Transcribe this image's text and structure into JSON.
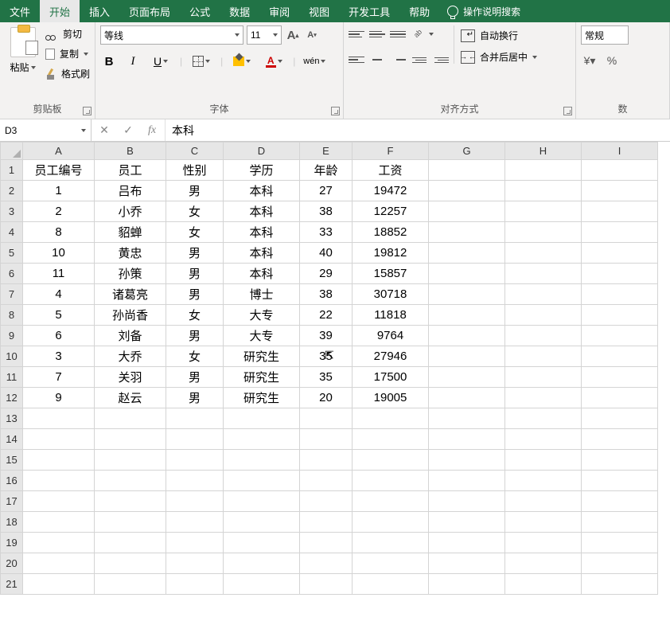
{
  "menu": {
    "tabs": [
      "文件",
      "开始",
      "插入",
      "页面布局",
      "公式",
      "数据",
      "审阅",
      "视图",
      "开发工具",
      "帮助"
    ],
    "active_index": 1,
    "search_placeholder": "操作说明搜索"
  },
  "ribbon": {
    "clipboard": {
      "paste": "粘贴",
      "cut": "剪切",
      "copy": "复制",
      "format_painter": "格式刷",
      "group_label": "剪贴板"
    },
    "font": {
      "name": "等线",
      "size": "11",
      "bold": "B",
      "italic": "I",
      "underline": "U",
      "inc_label": "A",
      "dec_label": "A",
      "color_label": "A",
      "phonetic": "wén",
      "group_label": "字体"
    },
    "alignment": {
      "wrap": "自动换行",
      "merge": "合并后居中",
      "group_label": "对齐方式"
    },
    "number": {
      "format": "常规",
      "percent": "%",
      "group_label": "数"
    }
  },
  "formula_bar": {
    "cell_ref": "D3",
    "fx_label": "fx",
    "value": "本科"
  },
  "grid": {
    "columns": [
      "A",
      "B",
      "C",
      "D",
      "E",
      "F",
      "G",
      "H",
      "I"
    ],
    "row_count": 21,
    "headers": [
      "员工编号",
      "员工",
      "性别",
      "学历",
      "年龄",
      "工资"
    ],
    "rows": [
      [
        "1",
        "吕布",
        "男",
        "本科",
        "27",
        "19472"
      ],
      [
        "2",
        "小乔",
        "女",
        "本科",
        "38",
        "12257"
      ],
      [
        "8",
        "貂蝉",
        "女",
        "本科",
        "33",
        "18852"
      ],
      [
        "10",
        "黄忠",
        "男",
        "本科",
        "40",
        "19812"
      ],
      [
        "11",
        "孙策",
        "男",
        "本科",
        "29",
        "15857"
      ],
      [
        "4",
        "诸葛亮",
        "男",
        "博士",
        "38",
        "30718"
      ],
      [
        "5",
        "孙尚香",
        "女",
        "大专",
        "22",
        "11818"
      ],
      [
        "6",
        "刘备",
        "男",
        "大专",
        "39",
        "9764"
      ],
      [
        "3",
        "大乔",
        "女",
        "研究生",
        "35",
        "27946"
      ],
      [
        "7",
        "关羽",
        "男",
        "研究生",
        "35",
        "17500"
      ],
      [
        "9",
        "赵云",
        "男",
        "研究生",
        "20",
        "19005"
      ]
    ]
  },
  "chart_data": {
    "type": "table",
    "title": "",
    "columns": [
      "员工编号",
      "员工",
      "性别",
      "学历",
      "年龄",
      "工资"
    ],
    "rows": [
      {
        "员工编号": 1,
        "员工": "吕布",
        "性别": "男",
        "学历": "本科",
        "年龄": 27,
        "工资": 19472
      },
      {
        "员工编号": 2,
        "员工": "小乔",
        "性别": "女",
        "学历": "本科",
        "年龄": 38,
        "工资": 12257
      },
      {
        "员工编号": 8,
        "员工": "貂蝉",
        "性别": "女",
        "学历": "本科",
        "年龄": 33,
        "工资": 18852
      },
      {
        "员工编号": 10,
        "员工": "黄忠",
        "性别": "男",
        "学历": "本科",
        "年龄": 40,
        "工资": 19812
      },
      {
        "员工编号": 11,
        "员工": "孙策",
        "性别": "男",
        "学历": "本科",
        "年龄": 29,
        "工资": 15857
      },
      {
        "员工编号": 4,
        "员工": "诸葛亮",
        "性别": "男",
        "学历": "博士",
        "年龄": 38,
        "工资": 30718
      },
      {
        "员工编号": 5,
        "员工": "孙尚香",
        "性别": "女",
        "学历": "大专",
        "年龄": 22,
        "工资": 11818
      },
      {
        "员工编号": 6,
        "员工": "刘备",
        "性别": "男",
        "学历": "大专",
        "年龄": 39,
        "工资": 9764
      },
      {
        "员工编号": 3,
        "员工": "大乔",
        "性别": "女",
        "学历": "研究生",
        "年龄": 35,
        "工资": 27946
      },
      {
        "员工编号": 7,
        "员工": "关羽",
        "性别": "男",
        "学历": "研究生",
        "年龄": 35,
        "工资": 17500
      },
      {
        "员工编号": 9,
        "员工": "赵云",
        "性别": "男",
        "学历": "研究生",
        "年龄": 20,
        "工资": 19005
      }
    ]
  }
}
